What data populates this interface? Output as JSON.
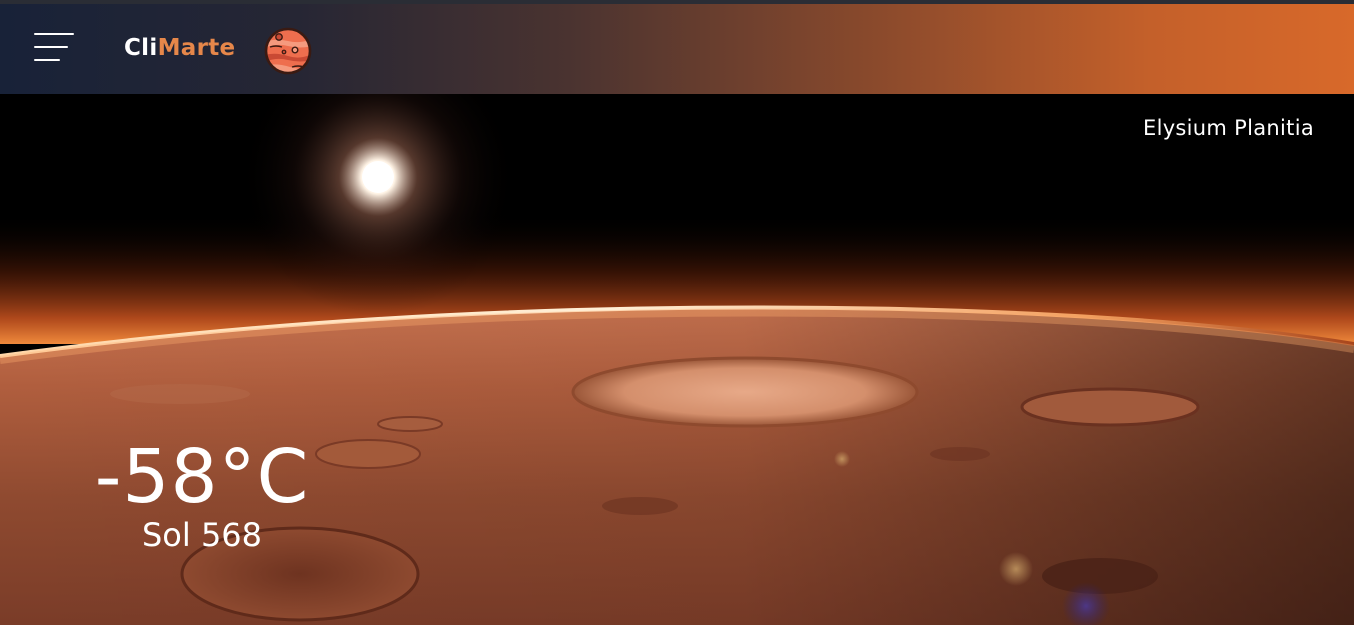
{
  "header": {
    "brand_part1": "Cli",
    "brand_part2": "Marte",
    "menu_icon": "hamburger-menu-icon",
    "logo_icon": "mars-planet-icon"
  },
  "hero": {
    "location": "Elysium Planitia",
    "temperature": "-58°C",
    "sol": "Sol 568"
  },
  "colors": {
    "nav_gradient_start": "#182238",
    "nav_gradient_end": "#d8692a",
    "brand_accent": "#e6874a",
    "text": "#ffffff"
  }
}
